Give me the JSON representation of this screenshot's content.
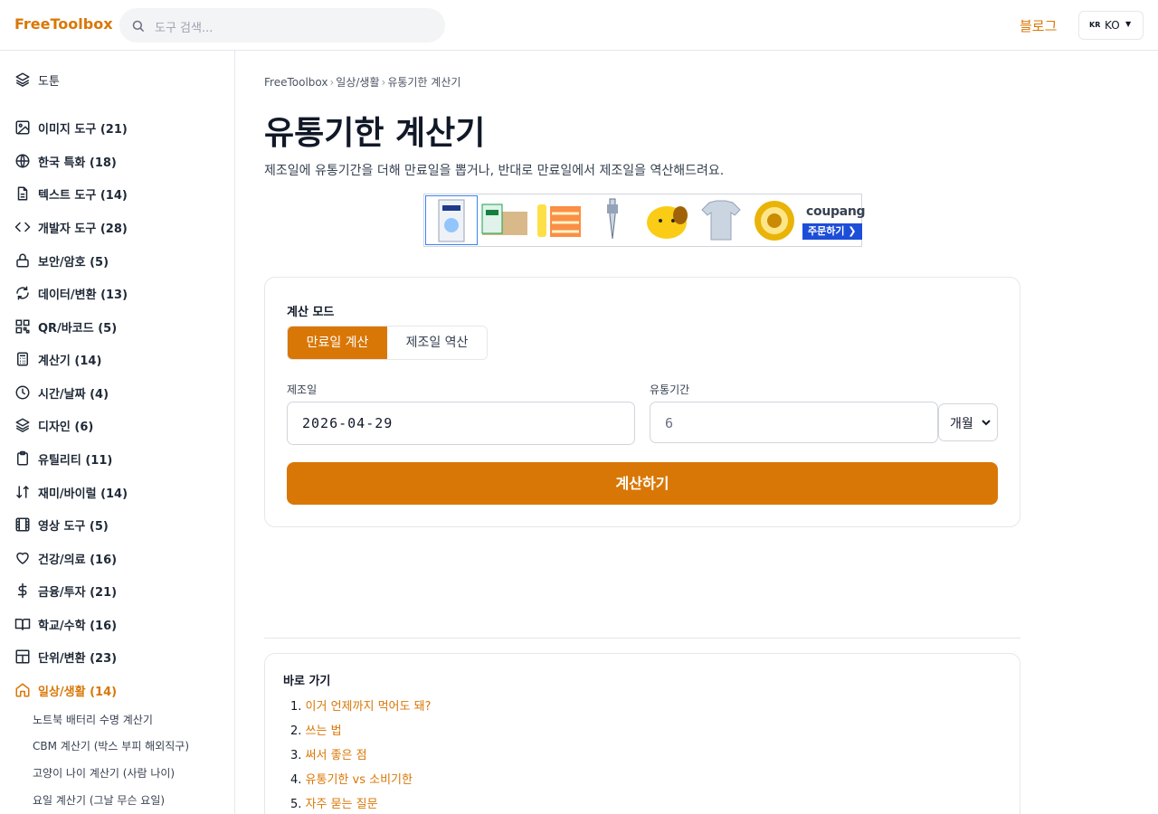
{
  "header": {
    "logo": "FreeToolbox",
    "search_placeholder": "도구 검색...",
    "blog_link": "블로그",
    "lang_flag": "KR",
    "lang_code": "KO"
  },
  "sidebar": {
    "top_item": "도툰",
    "categories": [
      {
        "label": "이미지 도구 (21)",
        "icon": "image-icon"
      },
      {
        "label": "한국 특화 (18)",
        "icon": "globe-icon"
      },
      {
        "label": "텍스트 도구 (14)",
        "icon": "file-text-icon"
      },
      {
        "label": "개발자 도구 (28)",
        "icon": "code-icon"
      },
      {
        "label": "보안/암호 (5)",
        "icon": "lock-icon"
      },
      {
        "label": "데이터/변환 (13)",
        "icon": "refresh-icon"
      },
      {
        "label": "QR/바코드 (5)",
        "icon": "qr-grid-icon"
      },
      {
        "label": "계산기 (14)",
        "icon": "calculator-icon"
      },
      {
        "label": "시간/날짜 (4)",
        "icon": "clock-icon"
      },
      {
        "label": "디자인 (6)",
        "icon": "layers-icon"
      },
      {
        "label": "유틸리티 (11)",
        "icon": "clipboard-icon"
      },
      {
        "label": "재미/바이럴 (14)",
        "icon": "shuffle-icon"
      },
      {
        "label": "영상 도구 (5)",
        "icon": "film-icon"
      },
      {
        "label": "건강/의료 (16)",
        "icon": "heart-icon"
      },
      {
        "label": "금융/투자 (21)",
        "icon": "dollar-icon"
      },
      {
        "label": "학교/수학 (16)",
        "icon": "book-icon"
      },
      {
        "label": "단위/변환 (23)",
        "icon": "table-icon"
      },
      {
        "label": "일상/생활 (14)",
        "icon": "home-icon"
      }
    ],
    "sub_items": [
      "노트북 배터리 수명 계산기",
      "CBM 계산기 (박스 부피 해외직구)",
      "고양이 나이 계산기 (사람 나이)",
      "요일 계산기 (그날 무슨 요일)"
    ]
  },
  "breadcrumb": [
    "FreeToolbox",
    "일상/생활",
    "유통기한 계산기"
  ],
  "page": {
    "title": "유통기한 계산기",
    "description": "제조일에 유통기간을 더해 만료일을 뽑거나, 반대로 만료일에서 제조일을 역산해드려요."
  },
  "ad": {
    "brand": "coupang",
    "order_label": "주문하기 ❯"
  },
  "calculator": {
    "mode_label": "계산 모드",
    "mode_options": [
      "만료일 계산",
      "제조일 역산"
    ],
    "manufacture_label": "제조일",
    "manufacture_value": "2026-04-29",
    "period_label": "유통기간",
    "period_value": "6",
    "unit_value": "개월",
    "calc_button": "계산하기"
  },
  "toc": {
    "title": "바로 가기",
    "items": [
      {
        "num": "1.",
        "label": "이거 언제까지 먹어도 돼?"
      },
      {
        "num": "2.",
        "label": "쓰는 법"
      },
      {
        "num": "3.",
        "label": "써서 좋은 점"
      },
      {
        "num": "4.",
        "label": "유통기한 vs 소비기한"
      },
      {
        "num": "5.",
        "label": "자주 묻는 질문"
      }
    ]
  },
  "colors": {
    "accent": "#d97706",
    "border": "#e5e7eb",
    "text": "#1f2937"
  }
}
